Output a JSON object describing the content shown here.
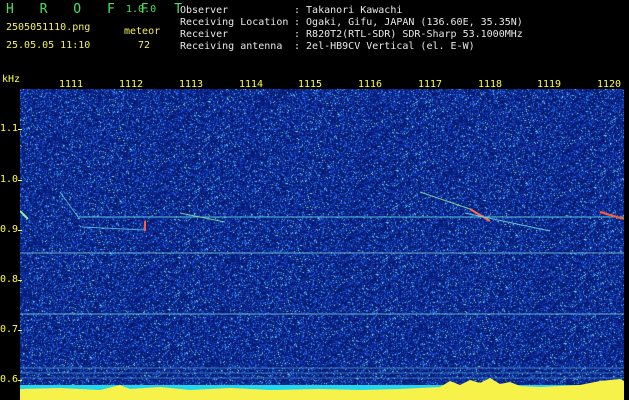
{
  "header": {
    "app_name": "H R O F F T",
    "version": "1.0.0",
    "filename": "2505051110.png",
    "datetime": "25.05.05 11:10",
    "detection_label": "meteor",
    "detection_count": "72",
    "info_labels": [
      "Observer",
      "Receiving Location",
      "Receiver",
      "Receiving antenna"
    ],
    "info_values": [
      ": Takanori Kawachi",
      ": Ogaki, Gifu, JAPAN (136.60E, 35.35N)",
      ": R820T2(RTL-SDR) SDR-Sharp 53.1000MHz",
      ": 2el-HB9CV Vertical (el. E-W)"
    ]
  },
  "axis": {
    "unit": "kHz",
    "time_ticks": [
      "1111",
      "1112",
      "1113",
      "1114",
      "1115",
      "1116",
      "1117",
      "1118",
      "1119",
      "1120"
    ],
    "freq_ticks": [
      "1.1",
      "1.0",
      "0.9",
      "0.8",
      "0.7",
      "0.6"
    ]
  },
  "colors": {
    "background": "#000000",
    "spectrum_base": "#071a70",
    "header_green": "#4fe05a",
    "header_yellow": "#f4f25a",
    "axis_yellow": "#ffff40"
  }
}
